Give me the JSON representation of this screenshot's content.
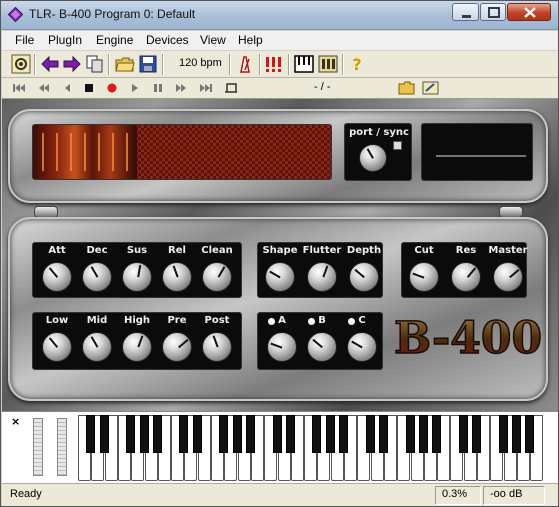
{
  "window": {
    "title": "TLR- B-400 Program 0: Default"
  },
  "menu": [
    "File",
    "PlugIn",
    "Engine",
    "Devices",
    "View",
    "Help"
  ],
  "toolbar": {
    "bpm": "120 bpm"
  },
  "transport": {
    "position": "- / -"
  },
  "synth": {
    "port_sync_label": "port / sync",
    "logo": "B-400",
    "envelope": [
      "Att",
      "Dec",
      "Sus",
      "Rel",
      "Clean"
    ],
    "modulation": [
      "Shape",
      "Flutter",
      "Depth"
    ],
    "filter": [
      "Cut",
      "Res",
      "Master"
    ],
    "eq": [
      "Low",
      "Mid",
      "High",
      "Pre",
      "Post"
    ],
    "voices": [
      "A",
      "B",
      "C"
    ]
  },
  "keyboard": {
    "close_label": "×"
  },
  "status": {
    "text": "Ready",
    "cpu": "0.3%",
    "level": "-oo dB"
  },
  "colors": {
    "titlebar": "#a9bfd8",
    "toolbar": "#ece9d8",
    "accent_purple": "#7a1fa8",
    "logo_red": "#8a1f1a"
  }
}
